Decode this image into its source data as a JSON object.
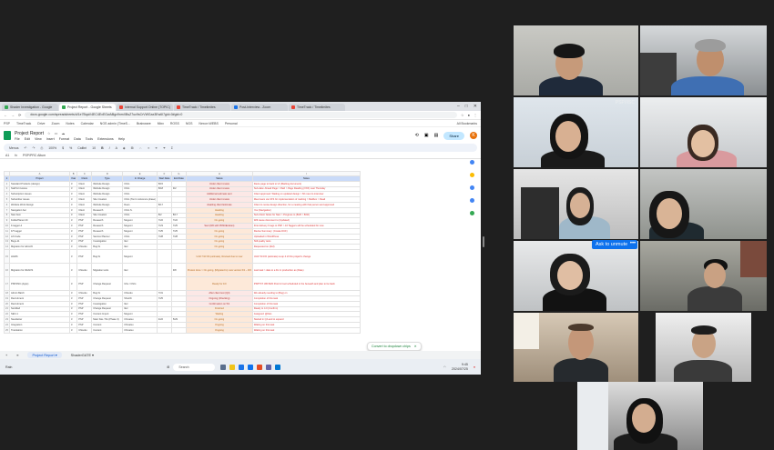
{
  "browser": {
    "tabs": [
      {
        "label": "Shader Investigation - Google",
        "icon": "sheets-icon",
        "active": false
      },
      {
        "label": "Project Report - Google Sheets",
        "icon": "sheets-icon",
        "active": true
      },
      {
        "label": "Internal Support Online (TOPIC)",
        "icon": "web-icon",
        "active": false
      },
      {
        "label": "TimeTrack / Timelimites",
        "icon": "web-icon",
        "active": false
      },
      {
        "label": "Post-Interview - Zoom",
        "icon": "zoom-icon",
        "active": false
      },
      {
        "label": "TimeTrack / Timelimites",
        "icon": "web-icon",
        "active": false
      }
    ],
    "url": "docs.google.com/spreadsheets/d/1e7BqaV4EC4ExEGwABgx9nmXBsZ7uc9sCrVWGax3Ew6I7gid=0#gid=0",
    "bookmarks": [
      "PSP",
      "TimeTrack",
      "Drive",
      "Zoom",
      "Notes",
      "Calendar",
      "NGS admin (TimeS...",
      "Brainware",
      "Mixx",
      "ROSS",
      "NGS",
      "Nexon WEBS",
      "Personal"
    ],
    "all_bookmarks": "All Bookmarks"
  },
  "sheet": {
    "title": "Project Report",
    "menus": [
      "File",
      "Edit",
      "View",
      "Insert",
      "Format",
      "Data",
      "Tools",
      "Extensions",
      "Help"
    ],
    "share_label": "Share",
    "user_initial": "K",
    "toolbar": {
      "menus": "Menus",
      "zoom": "100%",
      "currency": "$",
      "percent": "%",
      "font": "Calibri",
      "size": "10",
      "bold": "B",
      "italic": "I"
    },
    "name_box": "A1",
    "formula": "PSP/PRC Altum",
    "columns": [
      "A",
      "B",
      "C",
      "D",
      "E",
      "F",
      "G",
      "H",
      "I"
    ],
    "header": [
      "Project",
      "Year",
      "Client",
      "Type",
      "In Charge",
      "Start Date",
      "End Date",
      "Status",
      "Notes"
    ],
    "rows": [
      {
        "n": "2",
        "cells": [
          "Standard Products (design)",
          "3",
          "Client",
          "Website Design",
          "Chris",
          "8/15",
          "",
          "Under client review",
          "Dexie page to back to UI (Marking document)"
        ],
        "status_kind": "r"
      },
      {
        "n": "3",
        "cells": [
          "Staff & Invoices",
          "3",
          "Client",
          "Website Design",
          "Chris",
          "8/18",
          "9/2",
          "Under client review",
          "Sub-date: Ahead Page > Paid > Page Reading (XXX) Last Thursday"
        ],
        "status_kind": "r"
      },
      {
        "n": "4",
        "cells": [
          "Subscription Issues",
          "3",
          "Client",
          "Website Design",
          "Chris",
          "",
          "",
          "Additional estimate sent",
          "Client approved. Waiting on updated design > 60 meet to interview"
        ],
        "status_kind": "r"
      },
      {
        "n": "5",
        "cells": [
          "Subscriber issues",
          "3",
          "Client",
          "Site Creation",
          "Chris (Tom's reference phase)",
          "",
          "",
          "Under client review",
          "Meet team via CP.4 for implementation of marking > Mailbox > Read"
        ],
        "status_kind": "r"
      },
      {
        "n": "6",
        "cells": [
          "Website Work Design",
          "3",
          "Client",
          "Website Design",
          "Dean",
          "8/17",
          "",
          "Awaiting client Estimate",
          "Client to revise design direction, for a meeting with that person and approved"
        ],
        "status_kind": "r"
      },
      {
        "n": "7",
        "cells": [
          "Navigation bar",
          "3",
          "Client",
          "Research",
          "Chris S.",
          "",
          "",
          "Awaiting",
          "Yes (Navigation)"
        ],
        "status_kind": "o"
      },
      {
        "n": "8",
        "cells": [
          "Navi Item",
          "3",
          "Client",
          "Site Creation",
          "Chris",
          "8/2",
          "8/17",
          "Awaiting",
          "Sub-Client Notes for Navi > Progress to (8/20 > 8/02)"
        ],
        "status_kind": "o"
      },
      {
        "n": "9",
        "cells": [
          "FolderPlanet 4C",
          "3",
          "PSP",
          "Research",
          "Megumi",
          "7/22",
          "7/22",
          "On-going",
          "Will cause document to (Updated)"
        ],
        "status_kind": "o"
      },
      {
        "n": "10",
        "cells": [
          "F-tagger-4",
          "3",
          "PSP",
          "Research",
          "Megumi",
          "7/23",
          "7/25",
          "Sent (8/0 with PDSI/Endcan)",
          "First delivery 6 tags to PSP > 16 Taggers will be scheduled for now"
        ],
        "status_kind": "r"
      },
      {
        "n": "11",
        "cells": [
          "F/T-tagger",
          "3",
          "PSP",
          "Research",
          "Megumi",
          "7/25",
          "7/25",
          "On-going",
          "Revise Summary: (Create DCF)"
        ],
        "status_kind": "o"
      },
      {
        "n": "12",
        "cells": [
          "Lift Code",
          "3",
          "PSP",
          "Service Planner",
          "Chris",
          "7/28",
          "7/28",
          "On-going",
          "Uploaded in WordPress"
        ],
        "status_kind": "o"
      },
      {
        "n": "13",
        "cells": [
          "Bugs-11",
          "3",
          "PSP",
          "Investigation",
          "Ikel",
          "",
          "",
          "On-going",
          "Still quality tests"
        ],
        "status_kind": "o"
      },
      {
        "n": "14",
        "cells": [
          "Migration for Admin5",
          "3",
          "Chisoku",
          "Bug fix",
          "Ikel",
          "",
          "",
          "On-going",
          "Requested on (Ref)"
        ],
        "status_kind": "o"
      },
      {
        "n": "15",
        "cells": [
          "HGDS",
          "3",
          "PSP",
          "Bug fix",
          "Megumi",
          "",
          "",
          "Until 7/13 ID (estimate), Revised due to new",
          "Until 7/13 ID (estimate) Loup 4 of this project's change"
        ],
        "status_kind": "o",
        "tall": true
      },
      {
        "n": "16",
        "cells": [
          "Migration for WebOS",
          "3",
          "Chisoku",
          "Migration tools",
          "Ikel",
          "",
          "9/8",
          "Pretest done > On-going, (Migrated to) new version 6/1 ~ 8/4",
          "Last task > date to a Fix in production as (Date)"
        ],
        "status_kind": "o",
        "tall": true
      },
      {
        "n": "17",
        "cells": [
          "PSP/IISC (Apps)",
          "3",
          "PSP",
          "Change Request",
          "Ichu / Chris",
          "",
          "",
          "Ready for 10/",
          "PSPTST: Will 8/20 Post for tool scheduled in the beneath and plan to be back"
        ],
        "status_kind": "o",
        "tall": true
      },
      {
        "n": "18",
        "cells": [
          "Admin Batch",
          "3",
          "Chisoku",
          "Bug fix",
          "Chisoku",
          "7/31",
          "",
          "After client test (Q4)",
          "We already needing to (Bug) on"
        ],
        "status_kind": "r"
      },
      {
        "n": "19",
        "cells": [
          "Recruitment",
          "3",
          "PSP",
          "Change Request",
          "Shoichi",
          "7/25",
          "",
          "Ongoing (Checking)",
          "Completion of this task"
        ],
        "status_kind": "r"
      },
      {
        "n": "20",
        "cells": [
          "Recruitment",
          "3",
          "PSP",
          "Investigation",
          "Ikel",
          "",
          "",
          "Confirmation on 5/1",
          "Completion of this task"
        ],
        "status_kind": "r"
      },
      {
        "n": "21",
        "cells": [
          "Sentitled",
          "3",
          "PSP",
          "Change Request",
          "Ikel",
          "",
          "",
          "Finished",
          "Ready to 4.0 (Confirm)"
        ],
        "status_kind": "o"
      },
      {
        "n": "22",
        "cells": [
          "SEO-1",
          "3",
          "PSP",
          "Content Import",
          "Megumi",
          "",
          "",
          "Waiting",
          "Assigned: @Dan"
        ],
        "status_kind": "o"
      },
      {
        "n": "23",
        "cells": [
          "Newsletter",
          "3",
          "PSP",
          "Main Site / 5G (Phase 3)",
          "Chinatsu",
          "4/22",
          "5/29",
          "On-going",
          "Started in QA and to expand"
        ],
        "status_kind": "o"
      },
      {
        "n": "24",
        "cells": [
          "Integration",
          "3",
          "PSP",
          "Content",
          "Chinatsu",
          "",
          "",
          "Ongoing",
          "Waiting on this task"
        ],
        "status_kind": "o"
      },
      {
        "n": "25",
        "cells": [
          "Translation",
          "3",
          "Chisoku",
          "Content",
          "Chinatsu",
          "",
          "",
          "Ongoing",
          "Waiting on this task"
        ],
        "status_kind": "o"
      }
    ],
    "convert_chip": "Convert to dropdown chips",
    "sheet_tabs": [
      "Project Report",
      "ShaderGATE"
    ],
    "active_sheet_tab": "Project Report"
  },
  "taskbar": {
    "weather": "Rain",
    "search": "Search",
    "time": "9:45",
    "date": "2024/07/25"
  },
  "meeting": {
    "ask_to_unmute": "Ask to unmute",
    "more": "•••",
    "tile_label": "PSP/IISC"
  },
  "colors": {
    "grid_header": "#c9daf8",
    "status_red": "#fce8e6",
    "status_orange": "#fde9d9",
    "zoom_blue": "#0e72ed",
    "speaking_green": "#3cb043"
  }
}
